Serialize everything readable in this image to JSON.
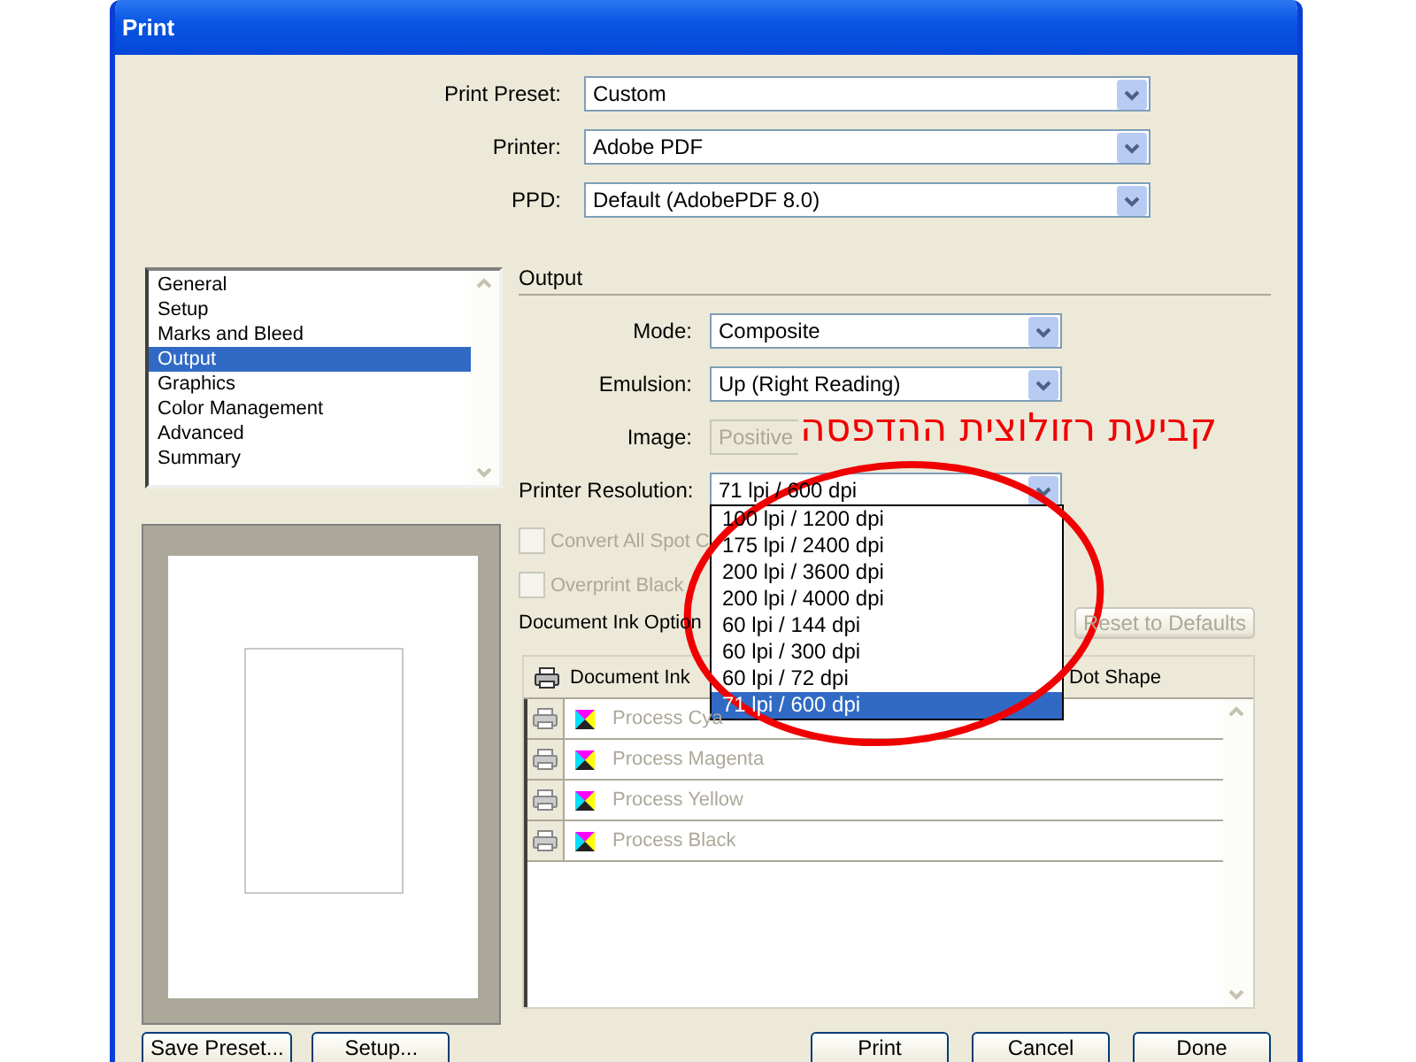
{
  "window": {
    "title": "Print"
  },
  "top_fields": [
    {
      "label": "Print Preset:",
      "value": "Custom"
    },
    {
      "label": "Printer:",
      "value": "Adobe PDF"
    },
    {
      "label": "PPD:",
      "value": "Default (AdobePDF 8.0)"
    }
  ],
  "categories": [
    {
      "label": "General",
      "selected": false
    },
    {
      "label": "Setup",
      "selected": false
    },
    {
      "label": "Marks and Bleed",
      "selected": false
    },
    {
      "label": "Output",
      "selected": true
    },
    {
      "label": "Graphics",
      "selected": false
    },
    {
      "label": "Color Management",
      "selected": false
    },
    {
      "label": "Advanced",
      "selected": false
    },
    {
      "label": "Summary",
      "selected": false
    }
  ],
  "section_title": "Output",
  "output_fields": [
    {
      "label": "Mode:",
      "value": "Composite",
      "disabled": false
    },
    {
      "label": "Emulsion:",
      "value": "Up (Right Reading)",
      "disabled": false
    },
    {
      "label": "Image:",
      "value": "Positive",
      "disabled": true
    },
    {
      "label": "Printer Resolution:",
      "value": "71 lpi / 600 dpi",
      "disabled": false
    }
  ],
  "resolution_options": [
    {
      "label": "100 lpi / 1200 dpi",
      "selected": false
    },
    {
      "label": "175 lpi / 2400 dpi",
      "selected": false
    },
    {
      "label": "200 lpi / 3600 dpi",
      "selected": false
    },
    {
      "label": "200 lpi / 4000 dpi",
      "selected": false
    },
    {
      "label": "60 lpi / 144 dpi",
      "selected": false
    },
    {
      "label": "60 lpi / 300 dpi",
      "selected": false
    },
    {
      "label": "60 lpi / 72 dpi",
      "selected": false
    },
    {
      "label": "71 lpi / 600 dpi",
      "selected": true
    }
  ],
  "checkboxes": [
    {
      "label": "Convert All Spot C",
      "checked": false,
      "disabled": true
    },
    {
      "label": "Overprint Black",
      "checked": false,
      "disabled": true
    }
  ],
  "ink_options": {
    "title": "Document Ink Option",
    "reset_button": {
      "label": "Reset to Defaults",
      "disabled": true
    },
    "columns": [
      "Document Ink",
      "Dot Shape"
    ],
    "rows": [
      "Process Cya",
      "Process Magenta",
      "Process Yellow",
      "Process Black"
    ]
  },
  "buttons_left": [
    "Save Preset...",
    "Setup..."
  ],
  "buttons_right": [
    "Print",
    "Cancel",
    "Done"
  ],
  "annotation": {
    "text": "קביעת רזולוצית ההדפסה"
  }
}
